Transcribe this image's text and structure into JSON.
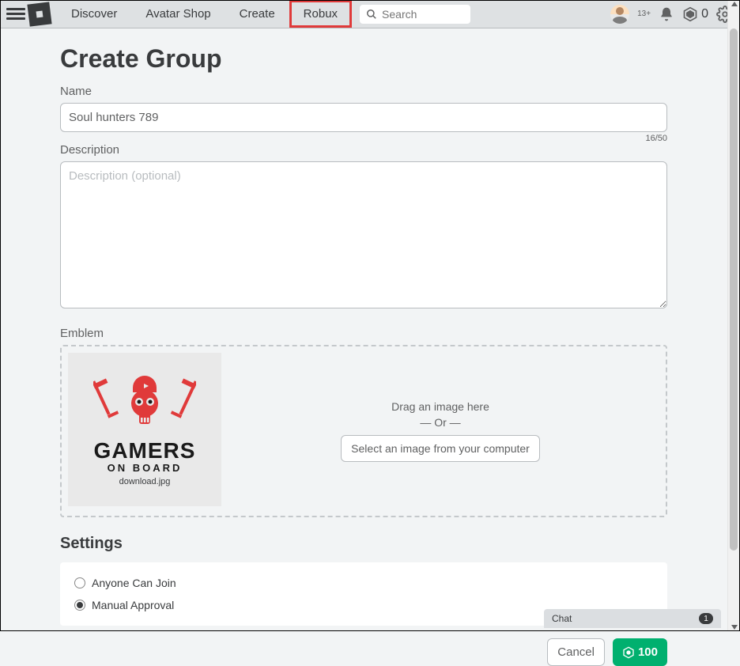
{
  "nav": {
    "links": [
      "Discover",
      "Avatar Shop",
      "Create",
      "Robux"
    ],
    "search_placeholder": "Search",
    "age_badge": "13+",
    "robux_balance": "0"
  },
  "page": {
    "title": "Create Group",
    "name_label": "Name",
    "name_value": "Soul hunters 789",
    "name_counter": "16/50",
    "description_label": "Description",
    "description_placeholder": "Description (optional)",
    "emblem_label": "Emblem",
    "emblem": {
      "drag_text": "Drag an image here",
      "or_text": "— Or —",
      "select_button": "Select an image from your computer",
      "thumb_line1": "GAMERS",
      "thumb_line2": "ON BOARD",
      "filename": "download.jpg"
    },
    "settings_title": "Settings",
    "settings": {
      "option_anyone": "Anyone Can Join",
      "option_manual": "Manual Approval"
    },
    "actions": {
      "cancel": "Cancel",
      "price": "100"
    }
  },
  "chat": {
    "label": "Chat",
    "badge": "1"
  }
}
